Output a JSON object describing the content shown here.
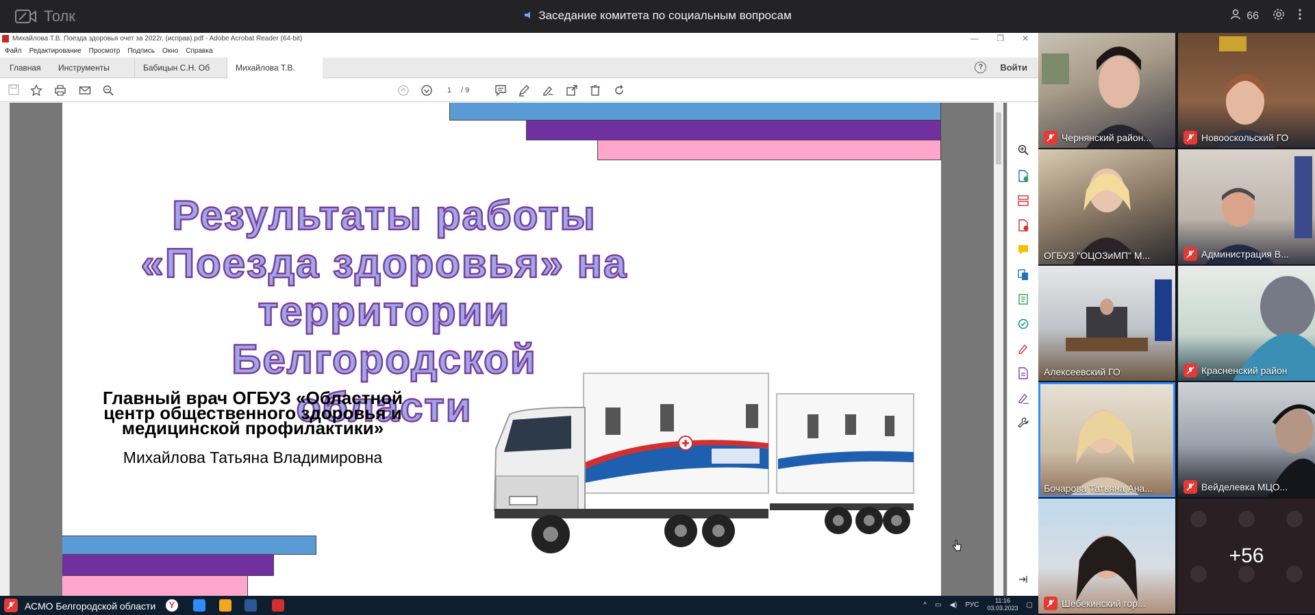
{
  "app": {
    "name": "Толк",
    "meeting_title": "Заседание комитета по социальным вопросам",
    "participants_count": "66"
  },
  "acrobat": {
    "window_title": "Михайлова Т.В. Поезда здоровья очет за 2022г. (исправ).pdf - Adobe Acrobat Reader (64-bit)",
    "menu": [
      "Файл",
      "Редактирование",
      "Просмотр",
      "Подпись",
      "Окно",
      "Справка"
    ],
    "tabs": {
      "home": "Главная",
      "tools": "Инструменты",
      "doc1": "Бабицын С.Н.  Об ...",
      "doc2": "Михайлова Т.В. По..."
    },
    "tab_close": "×",
    "login": "Войти",
    "help": "?",
    "page_current": "1",
    "page_total": "/ 9"
  },
  "slide": {
    "title_lines": [
      "Результаты работы",
      "«Поезда здоровья» на",
      "территории Белгородской",
      "области"
    ],
    "subtitle_lines": [
      "Главный врач ОГБУЗ «Областной",
      "центр общественного здоровья и",
      "медицинской профилактики»"
    ],
    "author": "Михайлова Татьяна Владимировна",
    "colors": {
      "blue": "#5b9bd5",
      "purple": "#7030a0",
      "pink": "#ffa6cd"
    }
  },
  "participants": [
    {
      "name": "Чернянский район...",
      "muted": true
    },
    {
      "name": "Новооскольский ГО",
      "muted": true
    },
    {
      "name": "ОГБУЗ \"ОЦОЗиМП\" М...",
      "muted": false
    },
    {
      "name": "Администрация В...",
      "muted": true
    },
    {
      "name": "Алексеевский ГО",
      "muted": false
    },
    {
      "name": "Красненский район",
      "muted": true
    },
    {
      "name": "Бочарова Татьяна Ана...",
      "muted": false,
      "speaking": true
    },
    {
      "name": "Вейделевка МЦО...",
      "muted": true
    },
    {
      "name": "Шебекинский гор...",
      "muted": true
    }
  ],
  "more_participants": "+56",
  "taskbar": {
    "app_label": "АСМО Белгородской области",
    "lang": "РУС",
    "time": "11:16",
    "date": "03.03.2023"
  }
}
